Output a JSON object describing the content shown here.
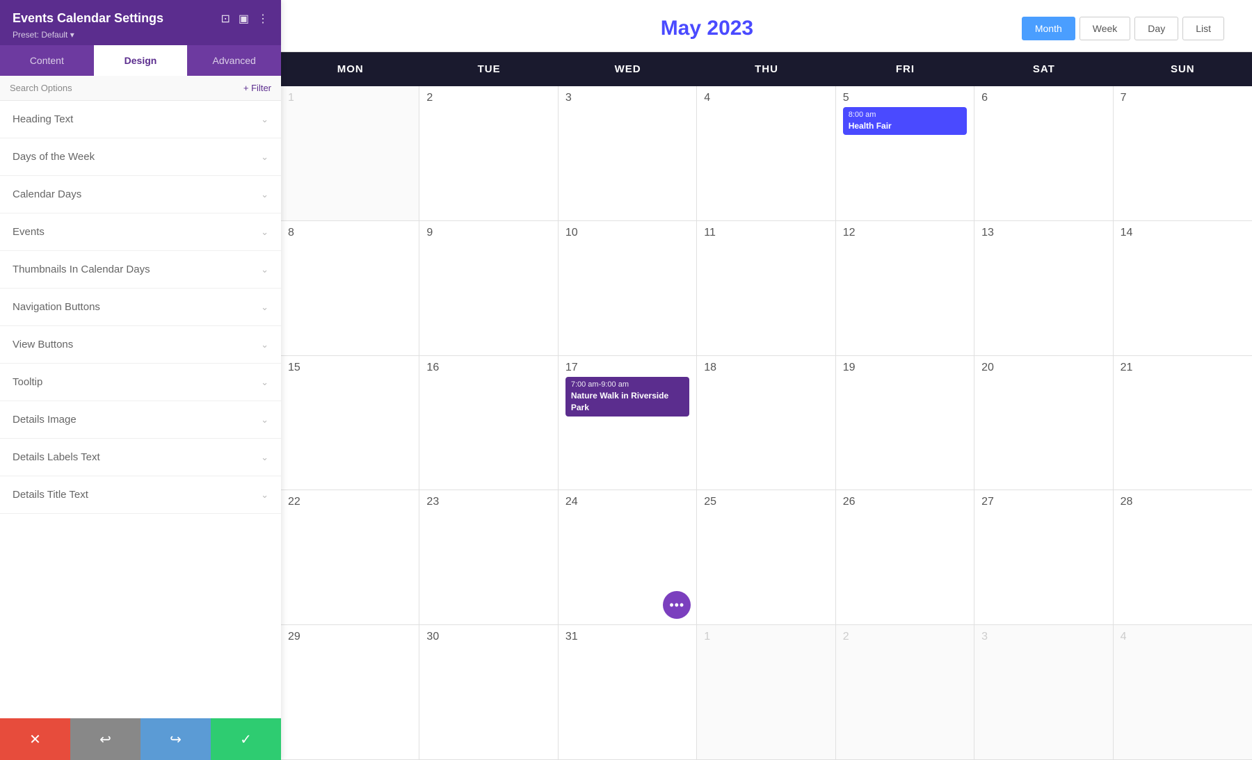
{
  "sidebar": {
    "title": "Events Calendar Settings",
    "preset": "Preset: Default ▾",
    "tabs": [
      {
        "label": "Content",
        "active": false
      },
      {
        "label": "Design",
        "active": true
      },
      {
        "label": "Advanced",
        "active": false
      }
    ],
    "search_label": "Search Options",
    "filter_label": "+ Filter",
    "items": [
      {
        "label": "Heading Text"
      },
      {
        "label": "Days of the Week"
      },
      {
        "label": "Calendar Days"
      },
      {
        "label": "Events"
      },
      {
        "label": "Thumbnails In Calendar Days"
      },
      {
        "label": "Navigation Buttons"
      },
      {
        "label": "View Buttons"
      },
      {
        "label": "Tooltip"
      },
      {
        "label": "Details Image"
      },
      {
        "label": "Details Labels Text"
      },
      {
        "label": "Details Title Text"
      }
    ],
    "footer": {
      "cancel": "✕",
      "undo": "↩",
      "redo": "↪",
      "save": "✓"
    }
  },
  "calendar": {
    "title": "May 2023",
    "view_buttons": [
      {
        "label": "Month",
        "active": true
      },
      {
        "label": "Week",
        "active": false
      },
      {
        "label": "Day",
        "active": false
      },
      {
        "label": "List",
        "active": false
      }
    ],
    "day_headers": [
      "MON",
      "TUE",
      "WED",
      "THU",
      "FRI",
      "SAT",
      "SUN"
    ],
    "weeks": [
      {
        "cells": [
          {
            "day": "1",
            "grayed": true,
            "events": []
          },
          {
            "day": "2",
            "events": []
          },
          {
            "day": "3",
            "events": []
          },
          {
            "day": "4",
            "events": []
          },
          {
            "day": "5",
            "events": [
              {
                "time": "8:00 am",
                "name": "Health Fair",
                "color": "blue"
              }
            ]
          },
          {
            "day": "6",
            "events": []
          },
          {
            "day": "7",
            "events": []
          }
        ]
      },
      {
        "cells": [
          {
            "day": "8",
            "events": []
          },
          {
            "day": "9",
            "events": []
          },
          {
            "day": "10",
            "events": []
          },
          {
            "day": "11",
            "events": []
          },
          {
            "day": "12",
            "events": []
          },
          {
            "day": "13",
            "events": []
          },
          {
            "day": "14",
            "events": []
          }
        ]
      },
      {
        "cells": [
          {
            "day": "15",
            "events": []
          },
          {
            "day": "16",
            "events": []
          },
          {
            "day": "17",
            "events": [
              {
                "time": "7:00 am-9:00 am",
                "name": "Nature Walk in Riverside Park",
                "color": "purple"
              }
            ]
          },
          {
            "day": "18",
            "events": []
          },
          {
            "day": "19",
            "events": []
          },
          {
            "day": "20",
            "events": []
          },
          {
            "day": "21",
            "events": []
          }
        ]
      },
      {
        "cells": [
          {
            "day": "22",
            "events": []
          },
          {
            "day": "23",
            "events": []
          },
          {
            "day": "24",
            "events": [],
            "has_dots": true
          },
          {
            "day": "25",
            "events": []
          },
          {
            "day": "26",
            "events": []
          },
          {
            "day": "27",
            "events": []
          },
          {
            "day": "28",
            "events": []
          }
        ]
      },
      {
        "cells": [
          {
            "day": "29",
            "events": []
          },
          {
            "day": "30",
            "events": []
          },
          {
            "day": "31",
            "events": []
          },
          {
            "day": "1",
            "grayed": true,
            "events": []
          },
          {
            "day": "2",
            "grayed": true,
            "events": []
          },
          {
            "day": "3",
            "grayed": true,
            "events": []
          },
          {
            "day": "4",
            "grayed": true,
            "events": []
          }
        ]
      }
    ]
  },
  "colors": {
    "sidebar_bg": "#5b2d8e",
    "sidebar_tab_bg": "#6d3aa0",
    "active_tab_text": "#5b2d8e",
    "calendar_title": "#4a4aff",
    "day_header_bg": "#1a1a2e",
    "event_blue": "#4a4aff",
    "event_purple": "#5b2d8e",
    "view_btn_active": "#4a9eff",
    "more_dots_bg": "#7b3fbe"
  }
}
